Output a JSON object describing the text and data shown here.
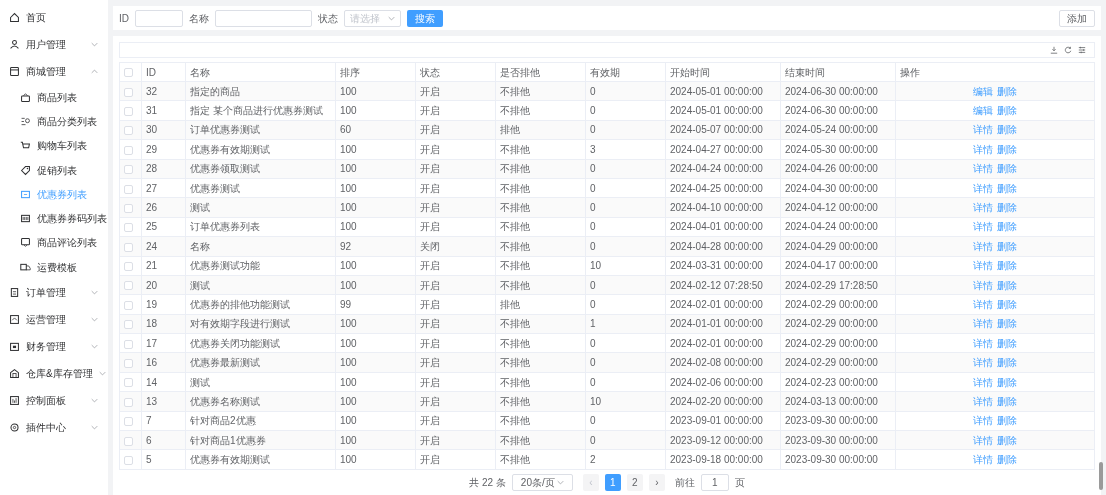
{
  "sidebar": {
    "items": [
      {
        "label": "首页",
        "selected": false
      },
      {
        "label": "用户管理",
        "expanded": false,
        "selected": false
      },
      {
        "label": "商城管理",
        "expanded": true,
        "selected": false,
        "children": [
          {
            "label": "商品列表",
            "selected": false
          },
          {
            "label": "商品分类列表",
            "selected": false
          },
          {
            "label": "购物车列表",
            "selected": false
          },
          {
            "label": "促销列表",
            "selected": false
          },
          {
            "label": "优惠券列表",
            "selected": true
          },
          {
            "label": "优惠券券码列表",
            "selected": false
          },
          {
            "label": "商品评论列表",
            "selected": false
          },
          {
            "label": "运费模板",
            "selected": false
          }
        ]
      },
      {
        "label": "订单管理",
        "expanded": false,
        "selected": false
      },
      {
        "label": "运营管理",
        "expanded": false,
        "selected": false
      },
      {
        "label": "财务管理",
        "expanded": false,
        "selected": false
      },
      {
        "label": "仓库&库存管理",
        "expanded": false,
        "selected": false
      },
      {
        "label": "控制面板",
        "expanded": false,
        "selected": false
      },
      {
        "label": "插件中心",
        "expanded": false,
        "selected": false
      }
    ]
  },
  "filter": {
    "fields": [
      {
        "kind": "input",
        "label": "ID"
      },
      {
        "kind": "input",
        "label": "名称"
      },
      {
        "kind": "select",
        "label": "状态",
        "placeholder": "请选择"
      }
    ],
    "search_button": "搜索",
    "add_button": "添加"
  },
  "table": {
    "select_all_checked": false,
    "columns": [
      "ID",
      "名称",
      "排序",
      "状态",
      "是否排他",
      "有效期",
      "开始时间",
      "结束时间",
      "操作"
    ],
    "rows": [
      {
        "checked": false,
        "cells": [
          "32",
          "指定的商品",
          "100",
          "开启",
          "不排他",
          "0",
          "2024-05-01 00:00:00",
          "2024-06-30 00:00:00"
        ],
        "actions": [
          "编辑",
          "删除"
        ]
      },
      {
        "checked": false,
        "cells": [
          "31",
          "指定 某个商品进行优惠券测试",
          "100",
          "开启",
          "不排他",
          "0",
          "2024-05-01 00:00:00",
          "2024-06-30 00:00:00"
        ],
        "actions": [
          "编辑",
          "删除"
        ]
      },
      {
        "checked": false,
        "cells": [
          "30",
          "订单优惠券测试",
          "60",
          "开启",
          "排他",
          "0",
          "2024-05-07 00:00:00",
          "2024-05-24 00:00:00"
        ],
        "actions": [
          "详情",
          "删除"
        ]
      },
      {
        "checked": false,
        "cells": [
          "29",
          "优惠券有效期测试",
          "100",
          "开启",
          "不排他",
          "3",
          "2024-04-27 00:00:00",
          "2024-05-30 00:00:00"
        ],
        "actions": [
          "详情",
          "删除"
        ]
      },
      {
        "checked": false,
        "cells": [
          "28",
          "优惠券领取测试",
          "100",
          "开启",
          "不排他",
          "0",
          "2024-04-24 00:00:00",
          "2024-04-26 00:00:00"
        ],
        "actions": [
          "详情",
          "删除"
        ]
      },
      {
        "checked": false,
        "cells": [
          "27",
          "优惠券测试",
          "100",
          "开启",
          "不排他",
          "0",
          "2024-04-25 00:00:00",
          "2024-04-30 00:00:00"
        ],
        "actions": [
          "详情",
          "删除"
        ]
      },
      {
        "checked": false,
        "cells": [
          "26",
          "测试",
          "100",
          "开启",
          "不排他",
          "0",
          "2024-04-10 00:00:00",
          "2024-04-12 00:00:00"
        ],
        "actions": [
          "详情",
          "删除"
        ]
      },
      {
        "checked": false,
        "cells": [
          "25",
          "订单优惠券列表",
          "100",
          "开启",
          "不排他",
          "0",
          "2024-04-01 00:00:00",
          "2024-04-24 00:00:00"
        ],
        "actions": [
          "详情",
          "删除"
        ]
      },
      {
        "checked": false,
        "cells": [
          "24",
          "名称",
          "92",
          "关闭",
          "不排他",
          "0",
          "2024-04-28 00:00:00",
          "2024-04-29 00:00:00"
        ],
        "actions": [
          "详情",
          "删除"
        ]
      },
      {
        "checked": false,
        "cells": [
          "21",
          "优惠券测试功能",
          "100",
          "开启",
          "不排他",
          "10",
          "2024-03-31 00:00:00",
          "2024-04-17 00:00:00"
        ],
        "actions": [
          "详情",
          "删除"
        ]
      },
      {
        "checked": false,
        "cells": [
          "20",
          "测试",
          "100",
          "开启",
          "不排他",
          "0",
          "2024-02-12 07:28:50",
          "2024-02-29 17:28:50"
        ],
        "actions": [
          "详情",
          "删除"
        ]
      },
      {
        "checked": false,
        "cells": [
          "19",
          "优惠券的排他功能测试",
          "99",
          "开启",
          "排他",
          "0",
          "2024-02-01 00:00:00",
          "2024-02-29 00:00:00"
        ],
        "actions": [
          "详情",
          "删除"
        ]
      },
      {
        "checked": false,
        "cells": [
          "18",
          "对有效期字段进行测试",
          "100",
          "开启",
          "不排他",
          "1",
          "2024-01-01 00:00:00",
          "2024-02-29 00:00:00"
        ],
        "actions": [
          "详情",
          "删除"
        ]
      },
      {
        "checked": false,
        "cells": [
          "17",
          "优惠券关闭功能测试",
          "100",
          "开启",
          "不排他",
          "0",
          "2024-02-01 00:00:00",
          "2024-02-29 00:00:00"
        ],
        "actions": [
          "详情",
          "删除"
        ]
      },
      {
        "checked": false,
        "cells": [
          "16",
          "优惠券最新测试",
          "100",
          "开启",
          "不排他",
          "0",
          "2024-02-08 00:00:00",
          "2024-02-29 00:00:00"
        ],
        "actions": [
          "详情",
          "删除"
        ]
      },
      {
        "checked": false,
        "cells": [
          "14",
          "测试",
          "100",
          "开启",
          "不排他",
          "0",
          "2024-02-06 00:00:00",
          "2024-02-23 00:00:00"
        ],
        "actions": [
          "详情",
          "删除"
        ]
      },
      {
        "checked": false,
        "cells": [
          "13",
          "优惠券名称测试",
          "100",
          "开启",
          "不排他",
          "10",
          "2024-02-20 00:00:00",
          "2024-03-13 00:00:00"
        ],
        "actions": [
          "详情",
          "删除"
        ]
      },
      {
        "checked": false,
        "cells": [
          "7",
          "针对商品2优惠",
          "100",
          "开启",
          "不排他",
          "0",
          "2023-09-01 00:00:00",
          "2023-09-30 00:00:00"
        ],
        "actions": [
          "详情",
          "删除"
        ]
      },
      {
        "checked": false,
        "cells": [
          "6",
          "针对商品1优惠券",
          "100",
          "开启",
          "不排他",
          "0",
          "2023-09-12 00:00:00",
          "2023-09-30 00:00:00"
        ],
        "actions": [
          "详情",
          "删除"
        ]
      },
      {
        "checked": false,
        "cells": [
          "5",
          "优惠券有效期测试",
          "100",
          "开启",
          "不排他",
          "2",
          "2023-09-18 00:00:00",
          "2023-09-30 00:00:00"
        ],
        "actions": [
          "详情",
          "删除"
        ]
      }
    ]
  },
  "pagination": {
    "total": "共 22 条",
    "page_size": "20条/页",
    "prev": "‹",
    "pages": [
      {
        "label": "1",
        "selected": true
      },
      {
        "label": "2",
        "selected": false
      }
    ],
    "next": "›",
    "goto_label": "前往",
    "goto_value": "1",
    "goto_suffix": "页"
  }
}
